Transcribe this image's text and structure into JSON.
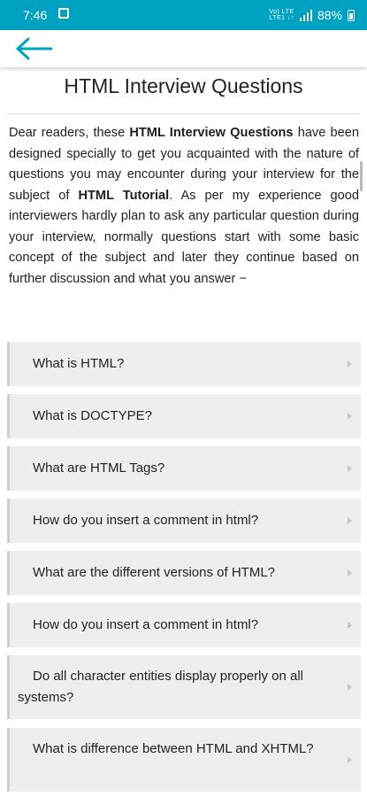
{
  "status_bar": {
    "time": "7:46",
    "network": "Vo) LTE\nLTE1 ↓↑",
    "battery_text": "88%"
  },
  "page": {
    "title": "HTML Interview Questions",
    "intro": {
      "p1": "Dear readers, these ",
      "b1": "HTML Interview Questions",
      "p2": " have been designed specially to get you acquainted with the nature of questions you may encounter during your interview for the subject of ",
      "b2": "HTML Tutorial",
      "p3": ". As per my experience good interviewers hardly plan to ask any particular question during your interview, normally questions start with some basic concept of the subject and later they continue based on further discussion and what you answer −"
    }
  },
  "questions": [
    "What is HTML?",
    "What is DOCTYPE?",
    "What are HTML Tags?",
    "How do you insert a comment in html?",
    "What are the different versions of HTML?",
    "How do you insert a comment in html?",
    "Do all character entities display properly on all systems?",
    "What is difference between HTML and XHTML?"
  ],
  "colors": {
    "status_bar": "#00a2c2",
    "accent": "#00a2c2",
    "item_background": "#eeeeee"
  },
  "icons": {
    "back": "arrow-left-icon",
    "expand": "chevron-right-icon"
  }
}
